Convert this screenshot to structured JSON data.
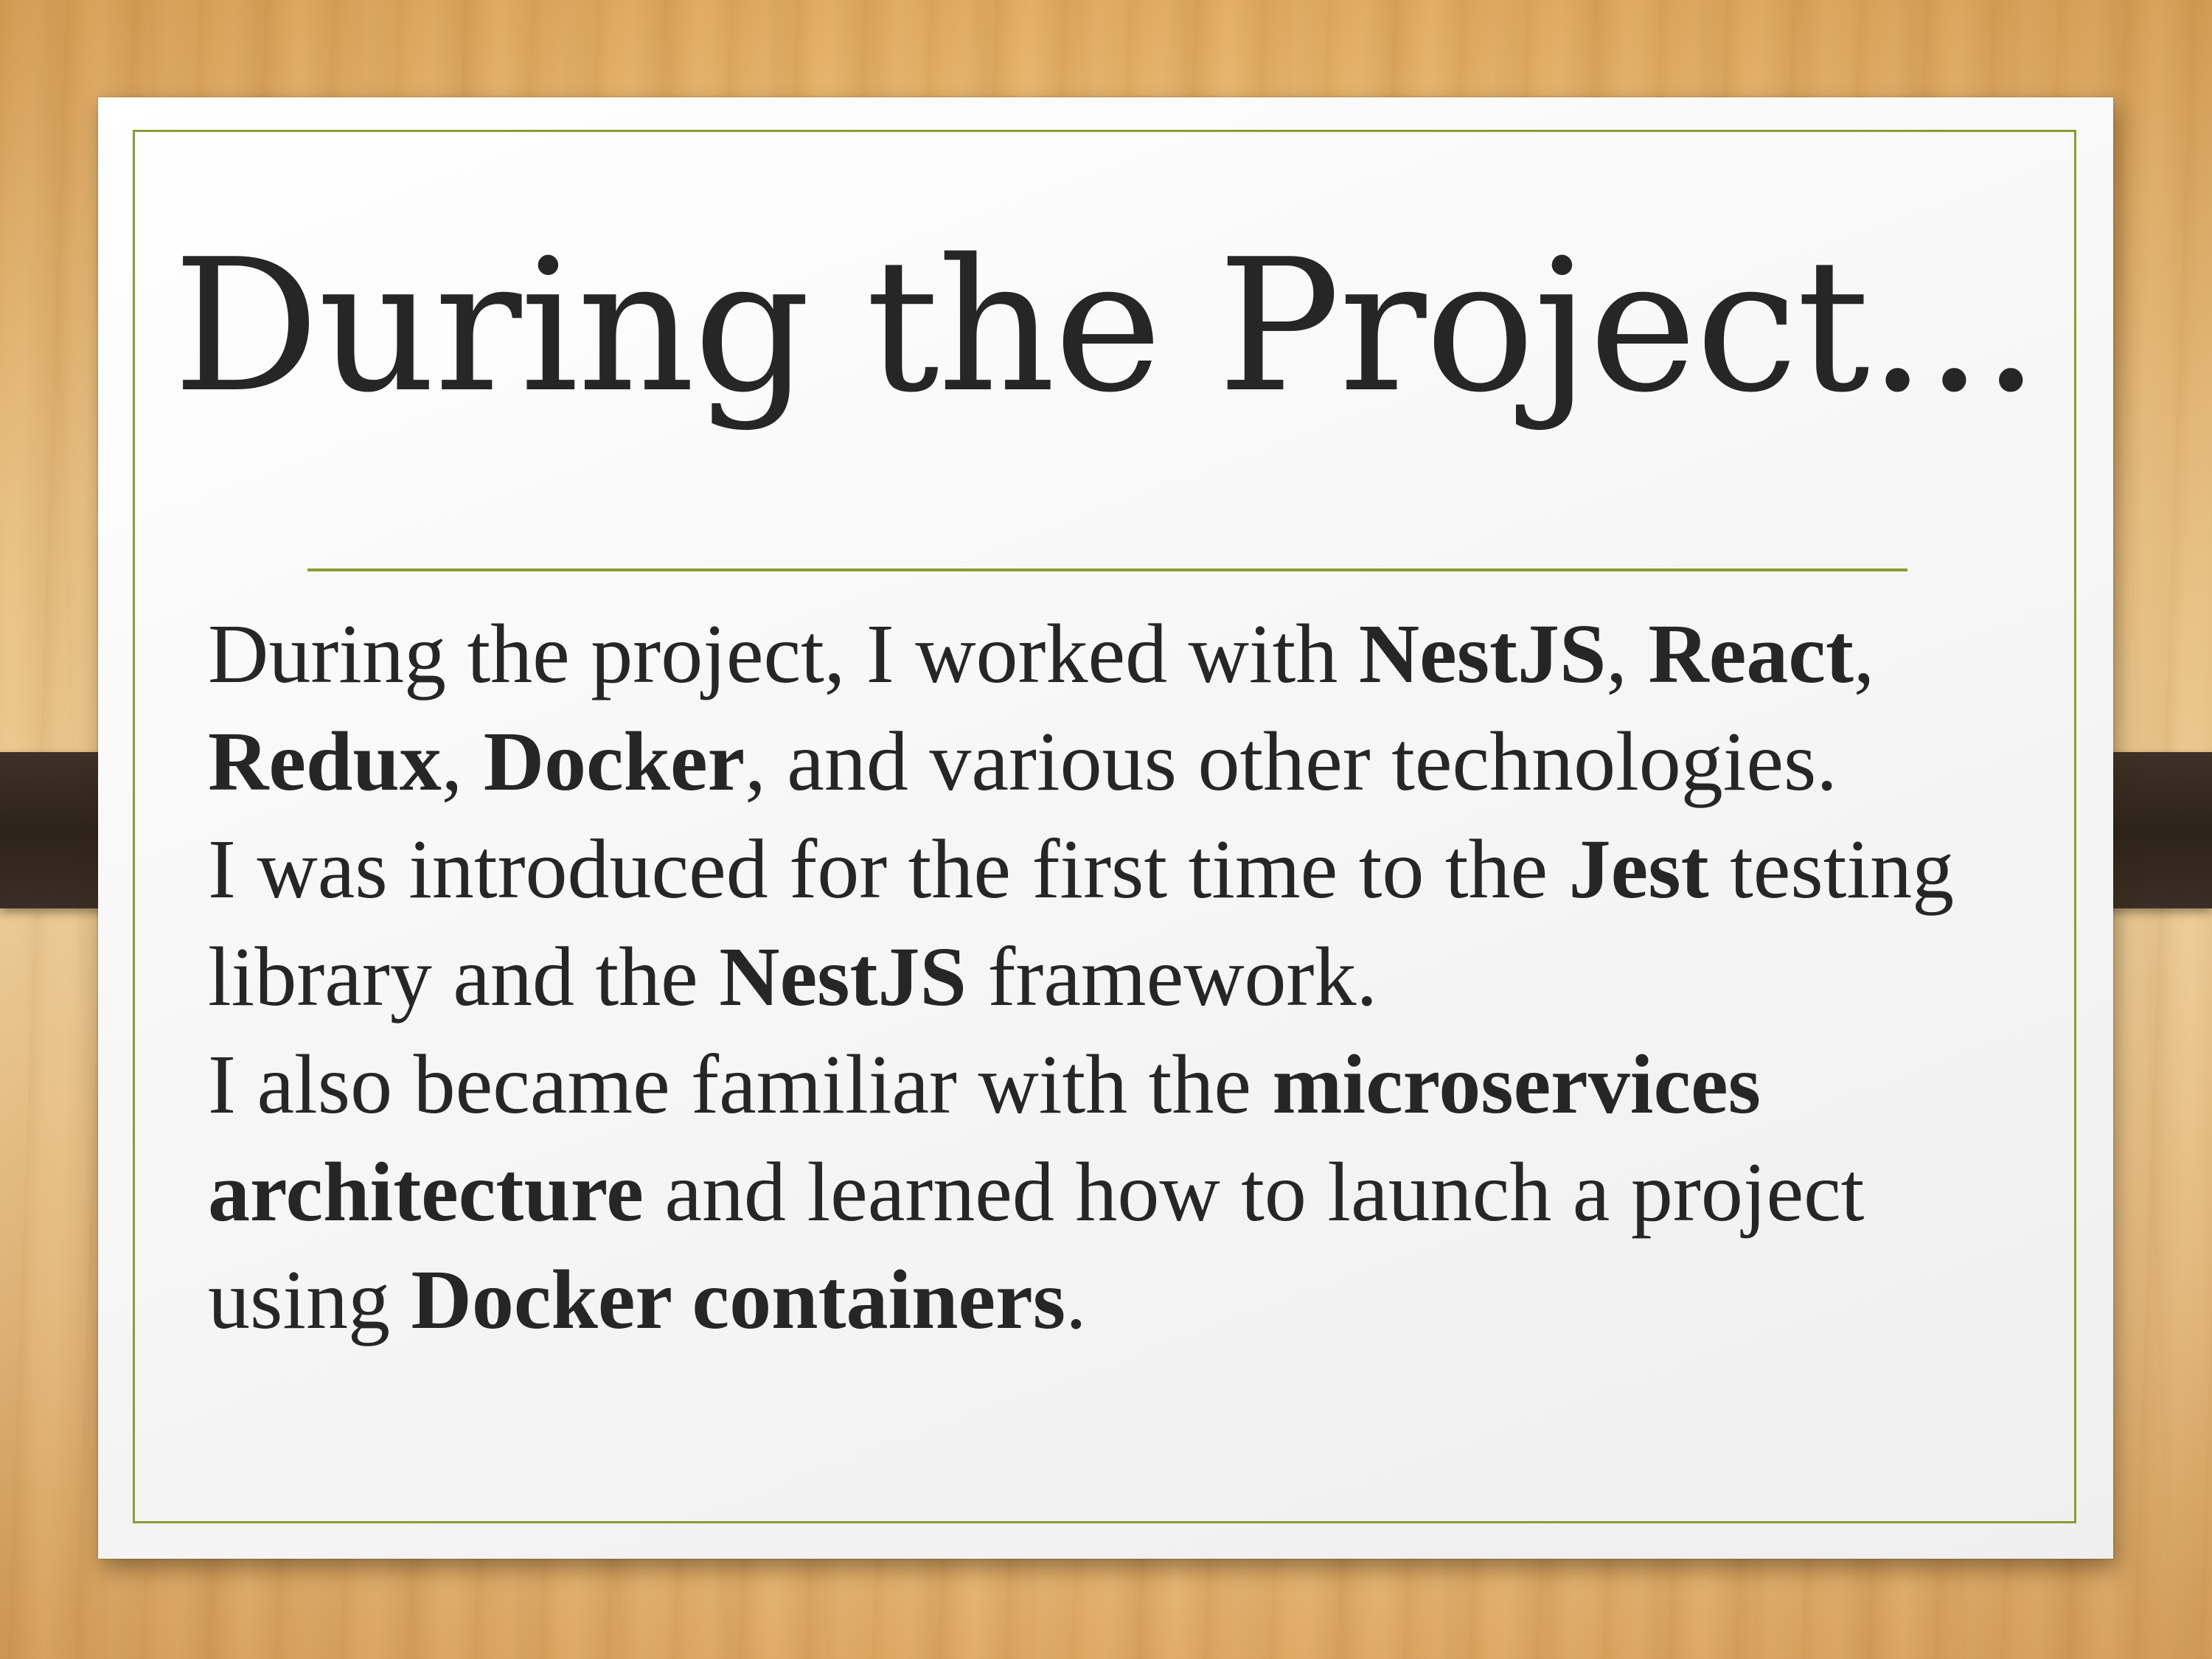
{
  "slide": {
    "title": "During the Project...",
    "paragraphs": [
      [
        {
          "text": "During the project, I worked with ",
          "bold": false
        },
        {
          "text": "NestJS",
          "bold": true
        },
        {
          "text": ", ",
          "bold": false
        },
        {
          "text": "React",
          "bold": true
        },
        {
          "text": ", ",
          "bold": false
        },
        {
          "text": "Redux",
          "bold": true
        },
        {
          "text": ", ",
          "bold": false
        },
        {
          "text": "Docker",
          "bold": true
        },
        {
          "text": ", and various other technologies.",
          "bold": false
        }
      ],
      [
        {
          "text": "I was introduced for the first time to the ",
          "bold": false
        },
        {
          "text": "Jest",
          "bold": true
        },
        {
          "text": " testing library and the ",
          "bold": false
        },
        {
          "text": "NestJS",
          "bold": true
        },
        {
          "text": " framework.",
          "bold": false
        }
      ],
      [
        {
          "text": "I also became familiar with the ",
          "bold": false
        },
        {
          "text": "microservices architecture",
          "bold": true
        },
        {
          "text": " and learned how to launch a project using ",
          "bold": false
        },
        {
          "text": "Docker containers",
          "bold": true
        },
        {
          "text": ".",
          "bold": false
        }
      ]
    ]
  },
  "colors": {
    "accent_green": "#8a9c35",
    "text": "#262626",
    "strap": "#2d241c",
    "wood": "#f0c98b"
  }
}
